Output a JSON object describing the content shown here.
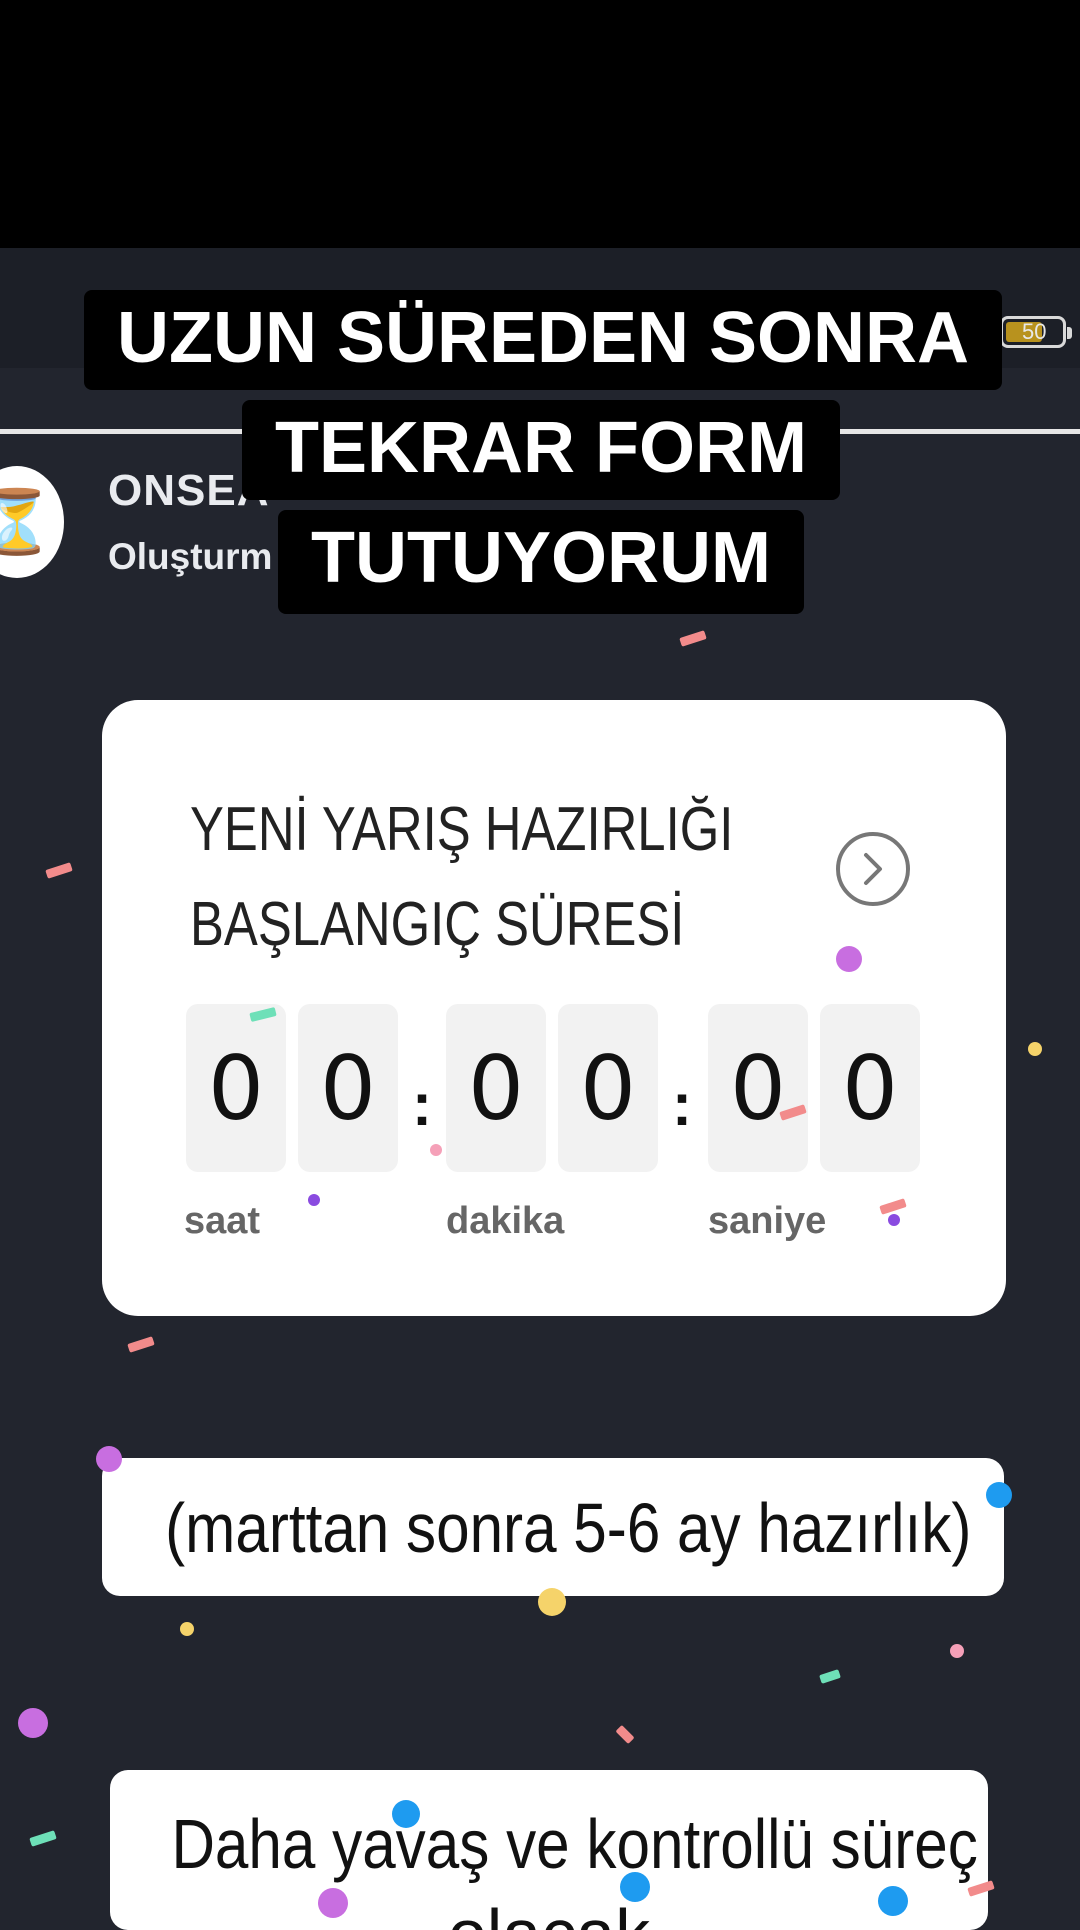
{
  "caption": {
    "line1": "UZUN SÜREDEN SONRA",
    "line2": "TEKRAR FORM",
    "line3": "TUTUYORUM"
  },
  "status": {
    "battery": "50"
  },
  "account": {
    "avatar_emoji": "⏳",
    "name": "ONSEA",
    "subtitle": "Oluşturm"
  },
  "countdown": {
    "title_line1": "YENİ YARIŞ HAZIRLIĞI",
    "title_line2": "BAŞLANGIÇ SÜRESİ",
    "digits": [
      "0",
      "0",
      "0",
      "0",
      "0",
      "0"
    ],
    "separator": ":",
    "units": {
      "hours": "saat",
      "minutes": "dakika",
      "seconds": "saniye"
    }
  },
  "notes": {
    "box1": "(marttan sonra 5-6 ay hazırlık)",
    "box2": "Daha yavaş ve kontrollü süreç",
    "box2_cut": "olacak"
  },
  "colors": {
    "background": "#22252e",
    "card": "#ffffff",
    "caption_bg": "#000000",
    "confetti": [
      "#f28b8b",
      "#c86ee0",
      "#1e9bf0",
      "#f5d36a",
      "#6ee0b8",
      "#8a4be0",
      "#f5a0b8"
    ]
  }
}
